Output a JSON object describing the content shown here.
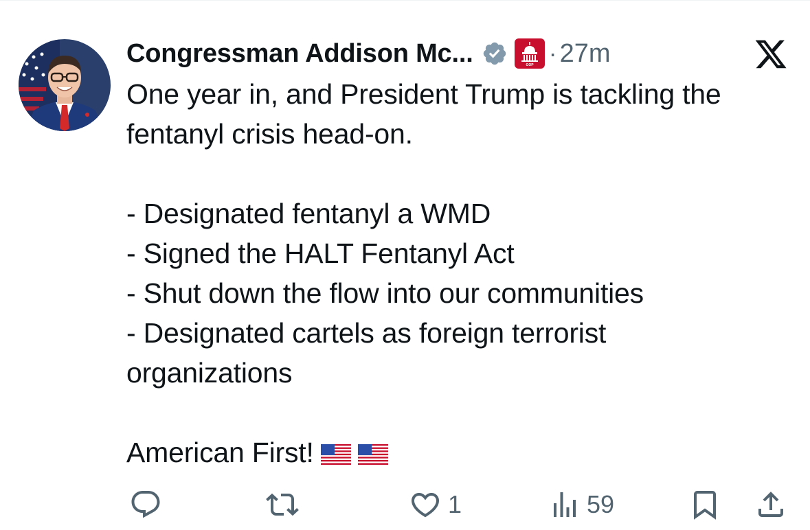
{
  "author": {
    "display_name": "Congressman Addison Mc...",
    "timestamp": "27m",
    "dot": "·",
    "avatar_icon": "profile-photo",
    "verified_icon": "verified-badge-icon",
    "affiliate_icon": "house-gop-badge",
    "affiliate_label": "GOP"
  },
  "platform": {
    "logo_icon": "x-logo"
  },
  "tweet": {
    "line1": "One year in, and President Trump is tackling the",
    "line2": "fentanyl crisis head-on.",
    "bullet1": "- Designated fentanyl a WMD",
    "bullet2": "- Signed the HALT Fentanyl Act",
    "bullet3": "- Shut down the flow into our communities",
    "bullet4": "- Designated cartels as foreign terrorist",
    "bullet4_cont": "organizations",
    "closing": "American First!",
    "emoji": [
      "🇺🇸",
      "🇺🇸"
    ]
  },
  "actions": {
    "reply_icon": "reply-icon",
    "retweet_icon": "retweet-icon",
    "like_icon": "heart-icon",
    "like_count": "1",
    "views_icon": "views-icon",
    "views_count": "59",
    "bookmark_icon": "bookmark-icon",
    "share_icon": "share-icon"
  },
  "colors": {
    "text": "#0f1419",
    "secondary": "#536471",
    "verified": "#829aab",
    "gop_red": "#c8102e"
  }
}
